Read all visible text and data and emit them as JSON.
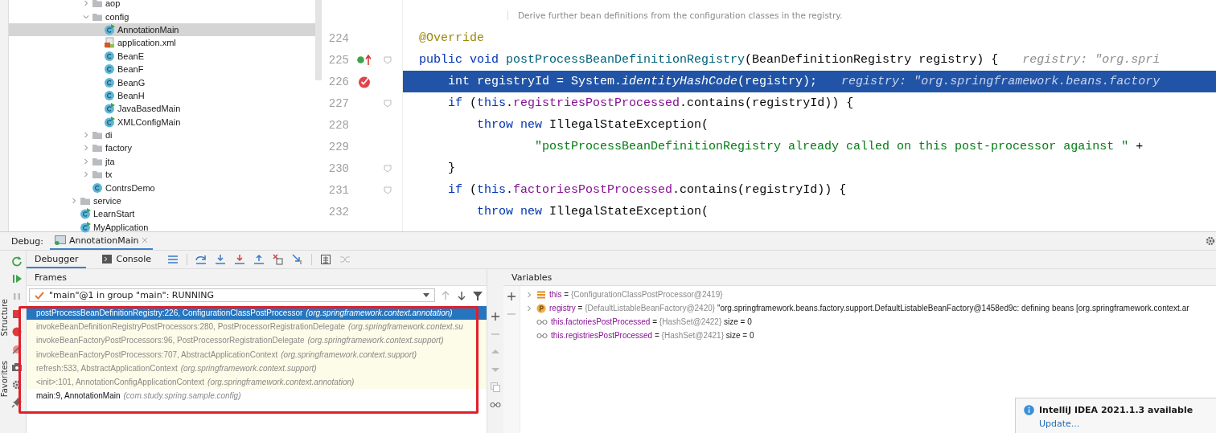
{
  "project_tree": [
    {
      "kind": "continuation",
      "children": [
        {
          "label": "aop",
          "kind": "folder",
          "expanded": false,
          "selected": false
        },
        {
          "label": "config",
          "kind": "folder",
          "expanded": true,
          "selected": false,
          "children": [
            {
              "label": "AnnotationMain",
              "kind": "main-class",
              "selected": true
            },
            {
              "label": "application.xml",
              "kind": "xml",
              "selected": false
            },
            {
              "label": "BeanE",
              "kind": "class",
              "selected": false
            },
            {
              "label": "BeanF",
              "kind": "class",
              "selected": false
            },
            {
              "label": "BeanG",
              "kind": "class",
              "selected": false
            },
            {
              "label": "BeanH",
              "kind": "class",
              "selected": false
            },
            {
              "label": "JavaBasedMain",
              "kind": "main-class",
              "selected": false
            },
            {
              "label": "XMLConfigMain",
              "kind": "main-class",
              "selected": false
            }
          ]
        },
        {
          "label": "di",
          "kind": "folder",
          "expanded": false,
          "selected": false
        },
        {
          "label": "factory",
          "kind": "folder",
          "expanded": false,
          "selected": false
        },
        {
          "label": "jta",
          "kind": "folder",
          "expanded": false,
          "selected": false
        },
        {
          "label": "tx",
          "kind": "folder",
          "expanded": false,
          "selected": false
        },
        {
          "label": "ContrsDemo",
          "kind": "class",
          "selected": false
        }
      ]
    },
    {
      "label": "service",
      "kind": "folder",
      "expanded": false,
      "selected": false
    },
    {
      "label": "LearnStart",
      "kind": "main-class",
      "selected": false
    },
    {
      "label": "MyApplication",
      "kind": "main-class",
      "selected": false
    }
  ],
  "editor": {
    "doc_comment": "Derive further bean definitions from the configuration classes in the registry.",
    "lines": [
      {
        "number": "224",
        "current": false,
        "fold": false,
        "tokens": [
          {
            "kind": "ann",
            "text": "@Override"
          }
        ]
      },
      {
        "number": "225",
        "current": false,
        "fold": true,
        "gutter": {
          "kind": "implements-override"
        },
        "tokens": [
          {
            "kind": "kw",
            "text": "public void "
          },
          {
            "kind": "decl",
            "text": "postProcessBeanDefinitionRegistry"
          },
          {
            "kind": "plain",
            "text": "(BeanDefinitionRegistry registry) {"
          },
          {
            "kind": "hint",
            "text": "registry: \"org.spri"
          }
        ]
      },
      {
        "number": "226",
        "current": true,
        "fold": false,
        "gutter": {
          "kind": "breakpoint"
        },
        "tokens": [
          {
            "kind": "kw",
            "text": "    int "
          },
          {
            "kind": "plain",
            "text": "registryId = System."
          },
          {
            "kind": "italic",
            "text": "identityHashCode"
          },
          {
            "kind": "plain",
            "text": "(registry);"
          },
          {
            "kind": "hint",
            "text": "registry: \"org.springframework.beans.factory"
          }
        ]
      },
      {
        "number": "227",
        "current": false,
        "fold": true,
        "tokens": [
          {
            "kind": "kw",
            "text": "    if "
          },
          {
            "kind": "plain",
            "text": "("
          },
          {
            "kind": "kw",
            "text": "this"
          },
          {
            "kind": "plain",
            "text": "."
          },
          {
            "kind": "field",
            "text": "registriesPostProcessed"
          },
          {
            "kind": "plain",
            "text": ".contains(registryId)) {"
          }
        ]
      },
      {
        "number": "228",
        "current": false,
        "fold": false,
        "tokens": [
          {
            "kind": "kw",
            "text": "        throw new "
          },
          {
            "kind": "plain",
            "text": "IllegalStateException("
          }
        ]
      },
      {
        "number": "229",
        "current": false,
        "fold": false,
        "tokens": [
          {
            "kind": "str",
            "text": "                \"postProcessBeanDefinitionRegistry already called on this post-processor against \""
          },
          {
            "kind": "plain",
            "text": " +"
          }
        ]
      },
      {
        "number": "230",
        "current": false,
        "fold": true,
        "tokens": [
          {
            "kind": "plain",
            "text": "    }"
          }
        ]
      },
      {
        "number": "231",
        "current": false,
        "fold": true,
        "tokens": [
          {
            "kind": "kw",
            "text": "    if "
          },
          {
            "kind": "plain",
            "text": "("
          },
          {
            "kind": "kw",
            "text": "this"
          },
          {
            "kind": "plain",
            "text": "."
          },
          {
            "kind": "field",
            "text": "factoriesPostProcessed"
          },
          {
            "kind": "plain",
            "text": ".contains(registryId)) {"
          }
        ]
      },
      {
        "number": "232",
        "current": false,
        "fold": false,
        "tokens": [
          {
            "kind": "kw",
            "text": "        throw new "
          },
          {
            "kind": "plain",
            "text": "IllegalStateException("
          }
        ]
      }
    ]
  },
  "debug": {
    "label": "Debug:",
    "session_tab": "AnnotationMain",
    "tabs": [
      {
        "label": "Debugger",
        "selected": true
      },
      {
        "label": "Console",
        "selected": false
      }
    ],
    "side_labels": [
      "Structure",
      "Favorites"
    ],
    "frames_title": "Frames",
    "thread": "\"main\"@1 in group \"main\": RUNNING",
    "frames": [
      {
        "method": "postProcessBeanDefinitionRegistry:226, ConfigurationClassPostProcessor",
        "package": "(org.springframework.context.annotation)",
        "kind": "library",
        "selected": true
      },
      {
        "method": "invokeBeanDefinitionRegistryPostProcessors:280, PostProcessorRegistrationDelegate",
        "package": "(org.springframework.context.su",
        "kind": "library",
        "selected": false
      },
      {
        "method": "invokeBeanFactoryPostProcessors:96, PostProcessorRegistrationDelegate",
        "package": "(org.springframework.context.support)",
        "kind": "library",
        "selected": false
      },
      {
        "method": "invokeBeanFactoryPostProcessors:707, AbstractApplicationContext",
        "package": "(org.springframework.context.support)",
        "kind": "library",
        "selected": false
      },
      {
        "method": "refresh:533, AbstractApplicationContext",
        "package": "(org.springframework.context.support)",
        "kind": "library",
        "selected": false
      },
      {
        "method": "<init>:101, AnnotationConfigApplicationContext",
        "package": "(org.springframework.context.annotation)",
        "kind": "library",
        "selected": false
      },
      {
        "method": "main:9, AnnotationMain",
        "package": "(com.study.spring.sample.config)",
        "kind": "user",
        "selected": false
      }
    ],
    "variables_title": "Variables",
    "variables": [
      {
        "name": "this",
        "operator": "=",
        "ref": "{ConfigurationClassPostProcessor@2419}",
        "kind": "object",
        "expandable": true
      },
      {
        "name": "registry",
        "operator": "=",
        "ref": "{DefaultListableBeanFactory@2420}",
        "extra": "\"org.springframework.beans.factory.support.DefaultListableBeanFactory@1458ed9c: defining beans [org.springframework.context.ar",
        "kind": "parameter",
        "expandable": true
      },
      {
        "name": "this.factoriesPostProcessed",
        "operator": "=",
        "ref": "{HashSet@2422}",
        "extra": "size = 0",
        "kind": "watch",
        "expandable": false
      },
      {
        "name": "this.registriesPostProcessed",
        "operator": "=",
        "ref": "{HashSet@2421}",
        "extra": "size = 0",
        "kind": "watch",
        "expandable": false
      }
    ]
  },
  "notification": {
    "title": "IntelliJ IDEA 2021.1.3 available",
    "action": "Update..."
  }
}
